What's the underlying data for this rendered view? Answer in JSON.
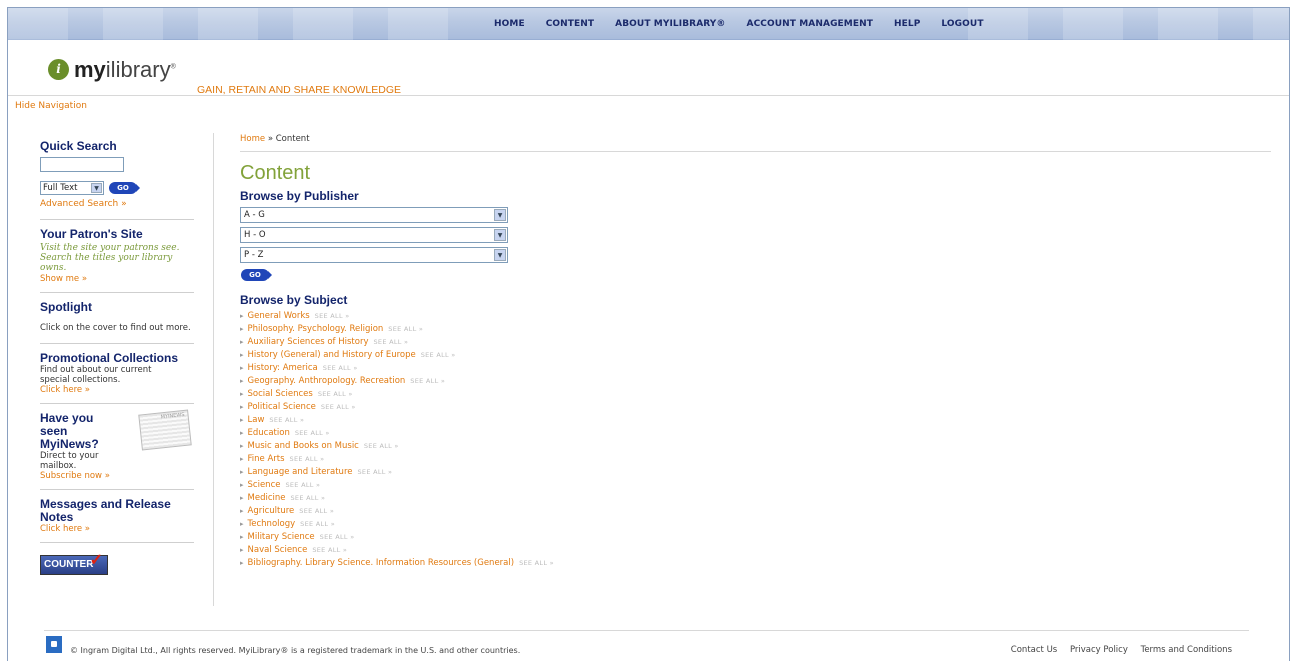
{
  "nav": {
    "items": [
      "HOME",
      "CONTENT",
      "ABOUT MYILIBRARY®",
      "ACCOUNT MANAGEMENT",
      "HELP",
      "LOGOUT"
    ]
  },
  "header": {
    "logo_prefix": "my",
    "logo_suffix": "ilibrary",
    "tagline": "GAIN, RETAIN AND SHARE KNOWLEDGE",
    "hide_nav": "Hide Navigation"
  },
  "sidebar": {
    "quick_search": {
      "title": "Quick Search",
      "input_value": "",
      "select_value": "Full Text",
      "go_label": "GO",
      "advanced": "Advanced Search »"
    },
    "patron": {
      "title": "Your Patron's Site",
      "desc": "Visit the site your patrons see. Search the titles your library owns.",
      "link": "Show me »"
    },
    "spotlight": {
      "title": "Spotlight",
      "desc": "Click on the cover to find out more."
    },
    "promo": {
      "title": "Promotional Collections",
      "desc": "Find out about our current special collections.",
      "link": "Click here »"
    },
    "news": {
      "title": "Have you seen MyiNews?",
      "desc": "Direct to your mailbox.",
      "link": "Subscribe now »",
      "image_label": "MYINEWS"
    },
    "messages": {
      "title": "Messages and Release Notes",
      "link": "Click here »"
    },
    "counter_label": "COUNTER"
  },
  "main": {
    "breadcrumb_home": "Home",
    "breadcrumb_sep": "»",
    "breadcrumb_current": "Content",
    "title": "Content",
    "browse_publisher": "Browse by Publisher",
    "publisher_selects": [
      "A - G",
      "H - O",
      "P - Z"
    ],
    "go_label": "GO",
    "browse_subject": "Browse by Subject",
    "see_all": "SEE ALL »",
    "subjects": [
      "General Works",
      "Philosophy. Psychology. Religion",
      "Auxiliary Sciences of History",
      "History (General) and History of Europe",
      "History: America",
      "Geography. Anthropology. Recreation",
      "Social Sciences",
      "Political Science",
      "Law",
      "Education",
      "Music and Books on Music",
      "Fine Arts",
      "Language and Literature",
      "Science",
      "Medicine",
      "Agriculture",
      "Technology",
      "Military Science",
      "Naval Science",
      "Bibliography. Library Science. Information Resources (General)"
    ]
  },
  "footer": {
    "copyright": "© Ingram Digital Ltd., All rights reserved. MyiLibrary® is a registered trademark in the U.S. and other countries.",
    "links": [
      "Contact Us",
      "Privacy Policy",
      "Terms and Conditions"
    ]
  },
  "colors": {
    "accent": "#e07a10",
    "heading": "#13246b",
    "title_green": "#82a23a"
  }
}
